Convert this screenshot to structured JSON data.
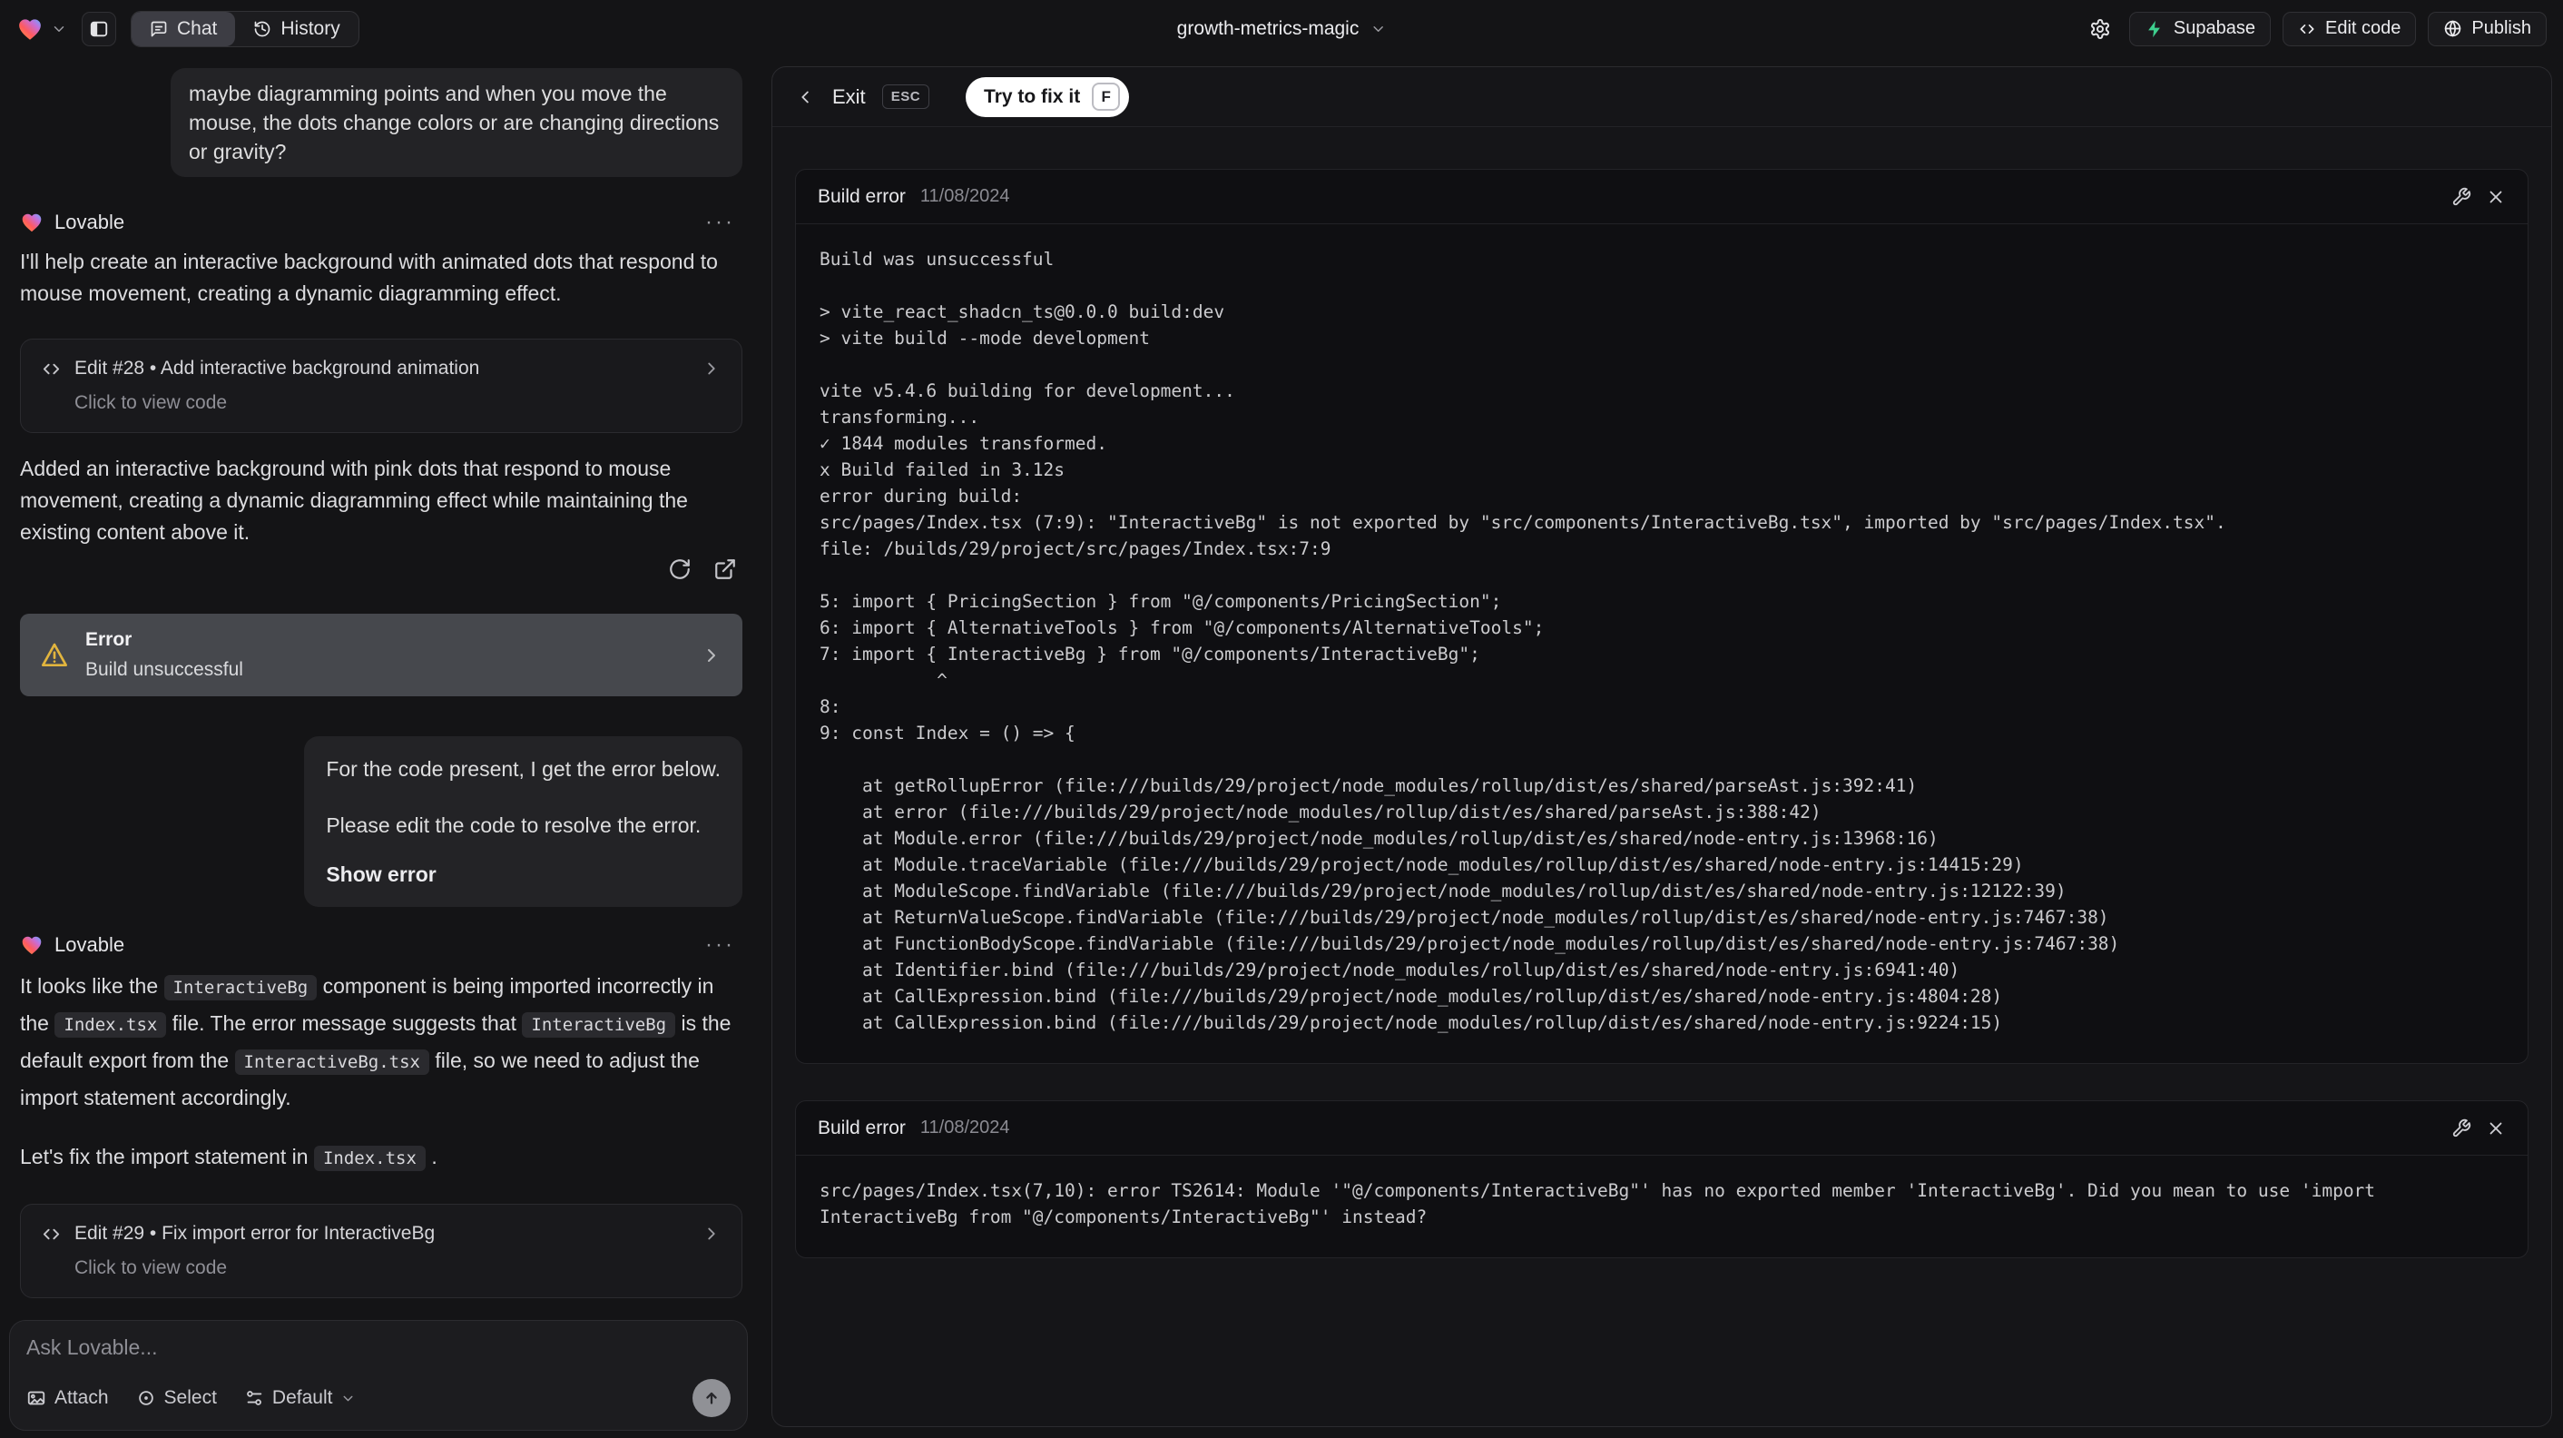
{
  "colors": {
    "accent_green": "#3ecf8e",
    "warning_amber": "#e2b53e"
  },
  "topbar": {
    "project_name": "growth-metrics-magic",
    "tab_chat": "Chat",
    "tab_history": "History",
    "supabase": "Supabase",
    "edit_code": "Edit code",
    "publish": "Publish"
  },
  "chat": {
    "assistant_name": "Lovable",
    "menu_dots": "···",
    "user_msg_1": "maybe diagramming points and when you move the mouse, the dots change colors or are changing directions or gravity?",
    "assistant_msg_1": "I'll help create an interactive background with animated dots that respond to mouse movement, creating a dynamic diagramming effect.",
    "edit_card_1": {
      "title": "Edit #28 • Add interactive background animation",
      "subtitle": "Click to view code"
    },
    "assistant_msg_2": "Added an interactive background with pink dots that respond to mouse movement, creating a dynamic diagramming effect while maintaining the existing content above it.",
    "error_card": {
      "title": "Error",
      "subtitle": "Build unsuccessful"
    },
    "user_msg_2": {
      "p1": "For the code present, I get the error below.",
      "p2": "Please edit the code to resolve the error.",
      "p3": "Show error"
    },
    "assistant_msg_3": {
      "t1": "It looks like the ",
      "c1": "InteractiveBg",
      "t2": " component is being imported incorrectly in the ",
      "c2": "Index.tsx",
      "t3": " file. The error message suggests that ",
      "c3": "InteractiveBg",
      "t4": " is the default export from the ",
      "c4": "InteractiveBg.tsx",
      "t5": " file, so we need to adjust the import statement accordingly."
    },
    "assistant_msg_4": {
      "t1": "Let's fix the import statement in ",
      "c1": "Index.tsx",
      "t2": " ."
    },
    "edit_card_2": {
      "title": "Edit #29 • Fix import error for InteractiveBg",
      "subtitle": "Click to view code"
    },
    "input": {
      "placeholder": "Ask Lovable...",
      "attach": "Attach",
      "select": "Select",
      "mode": "Default"
    }
  },
  "error_panel": {
    "exit": "Exit",
    "esc_key": "ESC",
    "fix_button": "Try to fix it",
    "fix_key": "F",
    "card1": {
      "title": "Build error",
      "date": "11/08/2024",
      "log": "Build was unsuccessful\n\n> vite_react_shadcn_ts@0.0.0 build:dev\n> vite build --mode development\n\nvite v5.4.6 building for development...\ntransforming...\n✓ 1844 modules transformed.\nx Build failed in 3.12s\nerror during build:\nsrc/pages/Index.tsx (7:9): \"InteractiveBg\" is not exported by \"src/components/InteractiveBg.tsx\", imported by \"src/pages/Index.tsx\".\nfile: /builds/29/project/src/pages/Index.tsx:7:9\n\n5: import { PricingSection } from \"@/components/PricingSection\";\n6: import { AlternativeTools } from \"@/components/AlternativeTools\";\n7: import { InteractiveBg } from \"@/components/InteractiveBg\";\n           ^\n8: \n9: const Index = () => {\n\n    at getRollupError (file:///builds/29/project/node_modules/rollup/dist/es/shared/parseAst.js:392:41)\n    at error (file:///builds/29/project/node_modules/rollup/dist/es/shared/parseAst.js:388:42)\n    at Module.error (file:///builds/29/project/node_modules/rollup/dist/es/shared/node-entry.js:13968:16)\n    at Module.traceVariable (file:///builds/29/project/node_modules/rollup/dist/es/shared/node-entry.js:14415:29)\n    at ModuleScope.findVariable (file:///builds/29/project/node_modules/rollup/dist/es/shared/node-entry.js:12122:39)\n    at ReturnValueScope.findVariable (file:///builds/29/project/node_modules/rollup/dist/es/shared/node-entry.js:7467:38)\n    at FunctionBodyScope.findVariable (file:///builds/29/project/node_modules/rollup/dist/es/shared/node-entry.js:7467:38)\n    at Identifier.bind (file:///builds/29/project/node_modules/rollup/dist/es/shared/node-entry.js:6941:40)\n    at CallExpression.bind (file:///builds/29/project/node_modules/rollup/dist/es/shared/node-entry.js:4804:28)\n    at CallExpression.bind (file:///builds/29/project/node_modules/rollup/dist/es/shared/node-entry.js:9224:15)"
    },
    "card2": {
      "title": "Build error",
      "date": "11/08/2024",
      "log": "src/pages/Index.tsx(7,10): error TS2614: Module '\"@/components/InteractiveBg\"' has no exported member 'InteractiveBg'. Did you mean to use 'import InteractiveBg from \"@/components/InteractiveBg\"' instead?"
    }
  }
}
